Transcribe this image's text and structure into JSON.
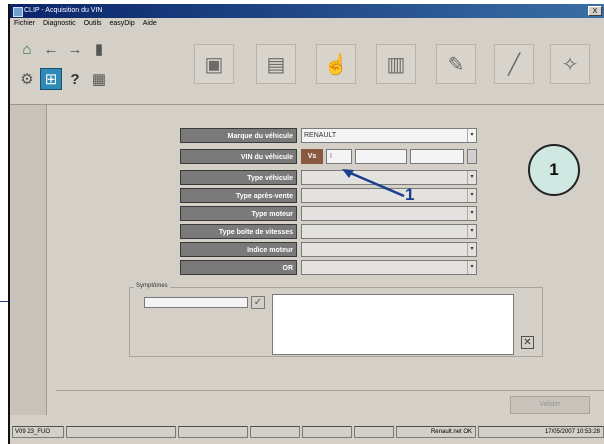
{
  "window": {
    "title": "CLIP - Acquisition du VIN",
    "close_label": "X"
  },
  "menu": [
    "Fichier",
    "Diagnostic",
    "Outils",
    "easyDip",
    "Aide"
  ],
  "toolbar": {
    "small_buttons": [
      {
        "name": "home-icon",
        "glyph": "⌂"
      },
      {
        "name": "back-arrow-icon",
        "glyph": "←"
      },
      {
        "name": "forward-arrow-icon",
        "glyph": "→"
      },
      {
        "name": "pages-icon",
        "glyph": "▮"
      },
      {
        "name": "vehicle-connect-icon",
        "glyph": "⚙"
      },
      {
        "name": "network-icon",
        "glyph": "⊞"
      },
      {
        "name": "help-icon",
        "glyph": "?"
      },
      {
        "name": "tools-icon",
        "glyph": "▦"
      }
    ],
    "big_tools": [
      {
        "name": "diagnostic-scan-icon",
        "glyph": "▣"
      },
      {
        "name": "ecu-icon",
        "glyph": "▤"
      },
      {
        "name": "hand-pointer-icon",
        "glyph": "☝"
      },
      {
        "name": "document-icon",
        "glyph": "▥"
      },
      {
        "name": "manual-icon",
        "glyph": "✎"
      },
      {
        "name": "wrench-icon",
        "glyph": "╱"
      },
      {
        "name": "spanner-icon",
        "glyph": "✧"
      }
    ]
  },
  "form": {
    "brand_label": "Marque du véhicule",
    "brand_value": "RENAULT",
    "vin_label": "VIN du véhicule",
    "vin_prefix": "Vs",
    "vin_segment": "I",
    "vehicle_type_label": "Type véhicule",
    "after_sales_type_label": "Type après-vente",
    "engine_type_label": "Type moteur",
    "gearbox_type_label": "Type boîte de vitesses",
    "engine_index_label": "Indice moteur",
    "or_label": "OR"
  },
  "symptoms": {
    "legend": "Symptômes"
  },
  "annotations": {
    "circle_label": "1",
    "callout_label": "1"
  },
  "footer": {
    "ok_label": "Valider"
  },
  "statusbar": {
    "version": "V09 23_FUO",
    "status": "Renault.net OK",
    "datetime": "17/05/2007 10:53:28"
  },
  "colors": {
    "title_start": "#0a246a",
    "label_bg": "#7a7a7a",
    "callout": "#1a3f8f",
    "circle_bg": "#cfe8e1"
  }
}
